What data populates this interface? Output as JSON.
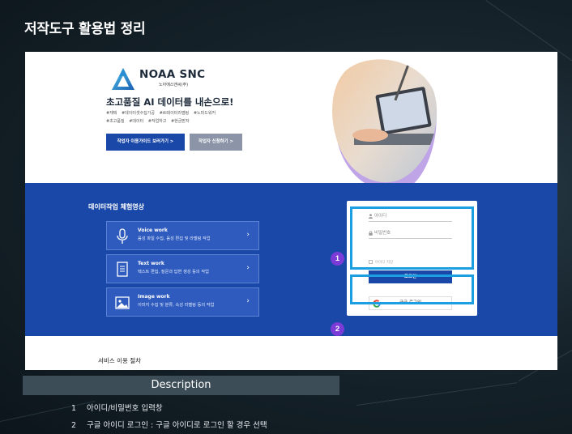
{
  "slide": {
    "title": "저작도구 활용법 정리"
  },
  "site": {
    "brand_name": "NOAA SNC",
    "brand_sub": "노아에스앤씨(주)",
    "headline": "초고품질 AI 데이터를 내손으로!",
    "tags": [
      "#재택",
      "#데이터셋수집가공",
      "#AI데이터라벨링",
      "#노마드워커",
      "#초고품질",
      "#데이터",
      "#작업하고",
      "#현금받자"
    ],
    "btn_guide": "작업자 이용가이드 보러가기 >",
    "btn_apply": "작업자 신청하기 >",
    "section_title": "데이터작업 체험영상",
    "work_items": [
      {
        "title": "Voice work",
        "desc": "음성 파일 수집, 음성 편집 및 라벨링 작업",
        "icon": "microphone-icon"
      },
      {
        "title": "Text work",
        "desc": "텍스트 편집, 질문과 답변 생성 등의 작업",
        "icon": "document-icon"
      },
      {
        "title": "Image work",
        "desc": "이미지 수집 및 분류, 속성 라벨링 등의 작업",
        "icon": "image-icon"
      }
    ],
    "login": {
      "id_placeholder": "아이디",
      "pw_placeholder": "비밀번호",
      "remember_label": "아이디 저장",
      "login_button": "로그인",
      "google_button": "구글 로그인"
    },
    "steps_title": "서비스 이용 절차"
  },
  "annotations": [
    {
      "number": "1"
    },
    {
      "number": "2"
    }
  ],
  "description": {
    "header": "Description",
    "items": [
      {
        "number": "1",
        "text": "아이디/비밀번호 입력창"
      },
      {
        "number": "2",
        "text": "구글 아이디 로그인 : 구글 아이디로 로그인 할 경우 선택"
      }
    ]
  },
  "colors": {
    "brand_blue": "#1a48a8",
    "highlight": "#1b9fe0",
    "badge": "#7b3bd6"
  }
}
